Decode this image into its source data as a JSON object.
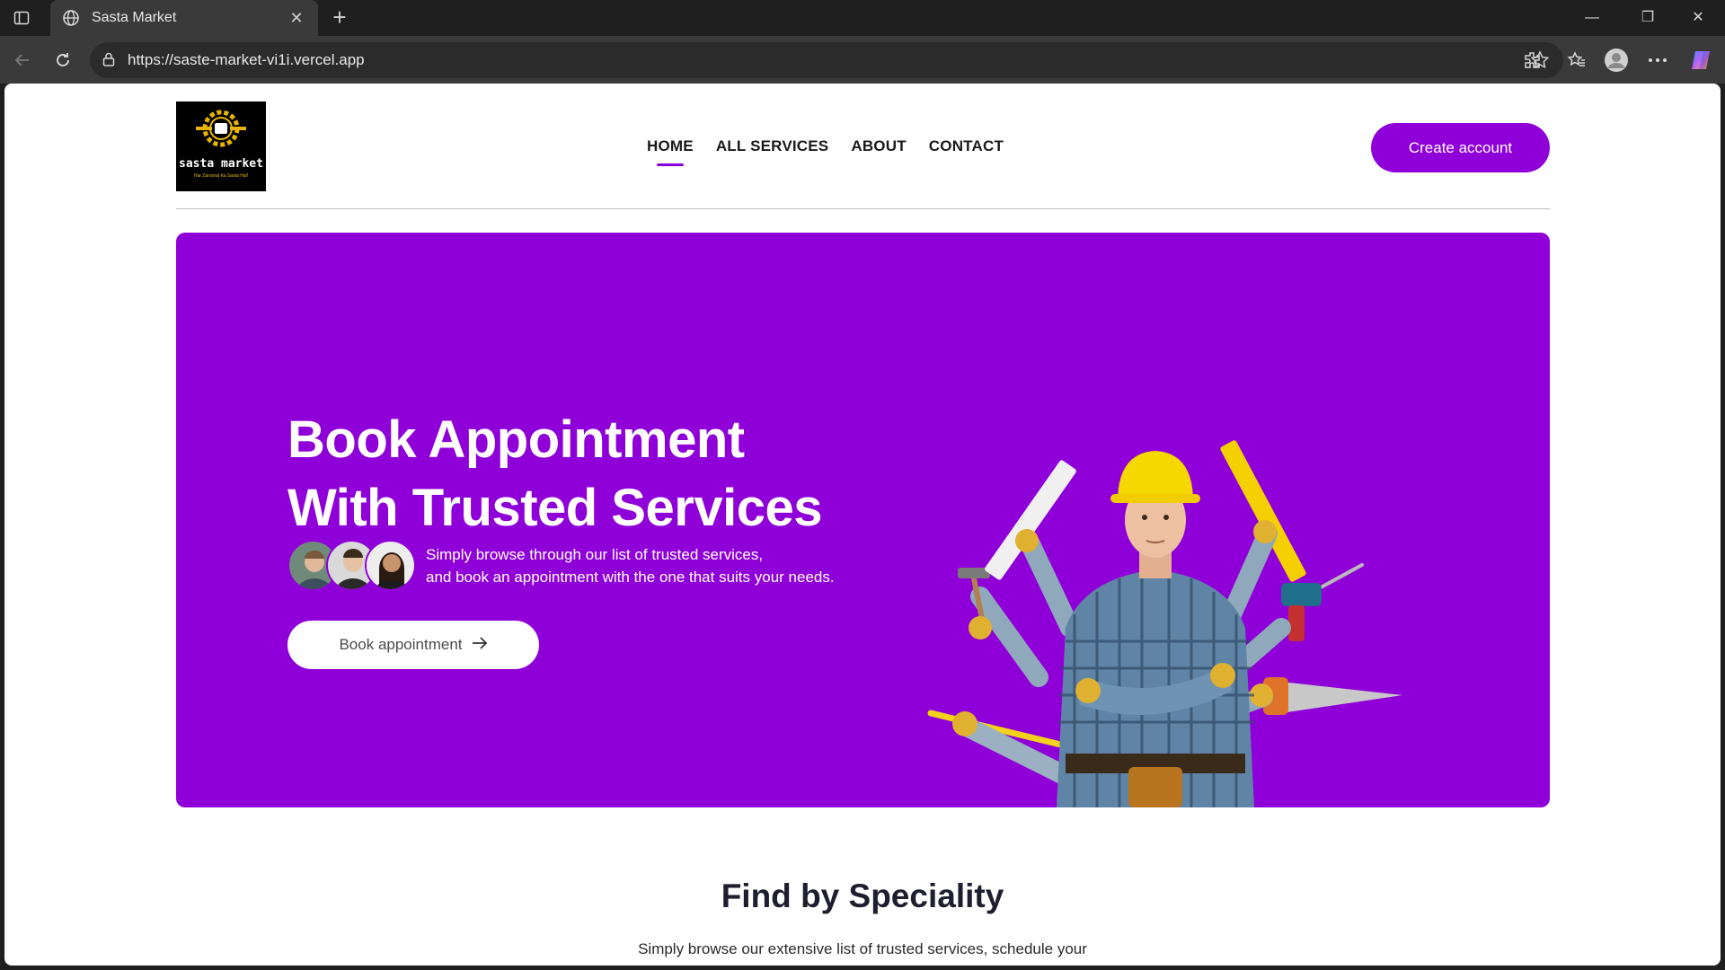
{
  "browser": {
    "tab_title": "Sasta Market",
    "url": "https://saste-market-vi1i.vercel.app"
  },
  "site": {
    "logo": {
      "name": "sasta market",
      "tagline": "Har Zaroorat Ka Sasta Hal!"
    },
    "nav": [
      "HOME",
      "ALL SERVICES",
      "ABOUT",
      "CONTACT"
    ],
    "active_nav": "HOME",
    "cta_label": "Create account"
  },
  "hero": {
    "title_line1": "Book Appointment",
    "title_line2": "With Trusted Services",
    "subtitle_line1": "Simply browse through our list of trusted services,",
    "subtitle_line2": "and book an appointment with the one that suits your needs.",
    "button_label": "Book appointment",
    "button_icon": "arrow-right-icon"
  },
  "speciality": {
    "title": "Find by Speciality",
    "subtitle": "Simply browse our extensive list of trusted services, schedule your"
  },
  "colors": {
    "brand": "#8f00d8",
    "chrome": "#1f1f1f",
    "toolbar": "#3a3a3a"
  }
}
